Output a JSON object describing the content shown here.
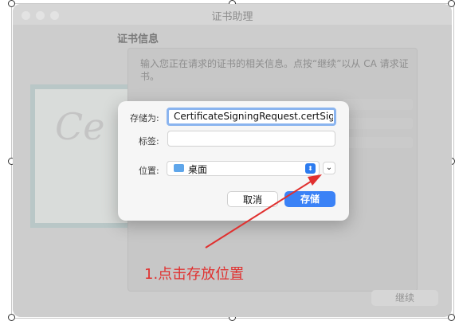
{
  "window": {
    "title": "证书助理",
    "section_title": "证书信息",
    "description": "输入您正在请求的证书的相关信息。点按“继续”以从 CA 请求证书。",
    "continue_label": "继续"
  },
  "dialog": {
    "save_as_label": "存储为:",
    "save_as_value": "CertificateSigningRequest.certSign",
    "tags_label": "标签:",
    "tags_value": "",
    "location_label": "位置:",
    "location_value": "桌面",
    "cancel_label": "取消",
    "save_label": "存储"
  },
  "annotation": {
    "text": "1.点击存放位置",
    "color": "#e0302f"
  },
  "colors": {
    "accent": "#3b82f6",
    "focus_ring": "#8ab4ef"
  },
  "icons": {
    "folder": "folder-icon",
    "updown": "chevron-updown-icon",
    "expand": "chevron-down-icon"
  }
}
